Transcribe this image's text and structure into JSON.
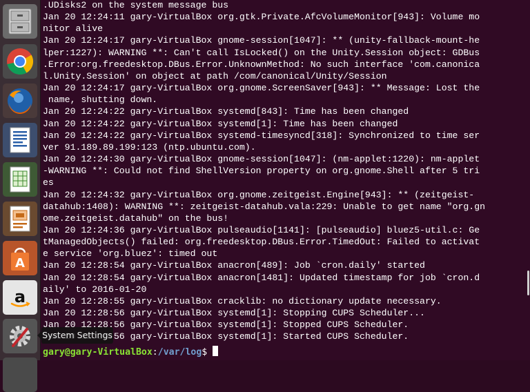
{
  "launcher": {
    "items": [
      {
        "name": "Files",
        "icon": "file-cabinet-icon"
      },
      {
        "name": "Chromium Web Browser",
        "icon": "chrome-icon"
      },
      {
        "name": "Firefox Web Browser",
        "icon": "firefox-icon"
      },
      {
        "name": "LibreOffice Writer",
        "icon": "writer-document-icon"
      },
      {
        "name": "LibreOffice Calc",
        "icon": "calc-spreadsheet-icon"
      },
      {
        "name": "LibreOffice Impress",
        "icon": "impress-presentation-icon"
      },
      {
        "name": "Ubuntu Software Center",
        "icon": "software-center-bag-icon"
      },
      {
        "name": "Amazon",
        "icon": "amazon-icon"
      },
      {
        "name": "System Settings",
        "icon": "settings-gear-wrench-icon"
      }
    ],
    "tooltip": "System Settings"
  },
  "terminal": {
    "lines": [
      ".UDisks2 on the system message bus",
      "Jan 20 12:24:11 gary-VirtualBox org.gtk.Private.AfcVolumeMonitor[943]: Volume mo",
      "nitor alive",
      "Jan 20 12:24:17 gary-VirtualBox gnome-session[1047]: ** (unity-fallback-mount-he",
      "lper:1227): WARNING **: Can't call IsLocked() on the Unity.Session object: GDBus",
      ".Error:org.freedesktop.DBus.Error.UnknownMethod: No such interface 'com.canonica",
      "l.Unity.Session' on object at path /com/canonical/Unity/Session",
      "Jan 20 12:24:17 gary-VirtualBox org.gnome.ScreenSaver[943]: ** Message: Lost the",
      " name, shutting down.",
      "Jan 20 12:24:22 gary-VirtualBox systemd[843]: Time has been changed",
      "Jan 20 12:24:22 gary-VirtualBox systemd[1]: Time has been changed",
      "Jan 20 12:24:22 gary-VirtualBox systemd-timesyncd[318]: Synchronized to time ser",
      "ver 91.189.89.199:123 (ntp.ubuntu.com).",
      "Jan 20 12:24:30 gary-VirtualBox gnome-session[1047]: (nm-applet:1220): nm-applet",
      "-WARNING **: Could not find ShellVersion property on org.gnome.Shell after 5 tri",
      "es",
      "Jan 20 12:24:32 gary-VirtualBox org.gnome.zeitgeist.Engine[943]: ** (zeitgeist-",
      "datahub:1408): WARNING **: zeitgeist-datahub.vala:229: Unable to get name \"org.gn",
      "ome.zeitgeist.datahub\" on the bus!",
      "Jan 20 12:24:36 gary-VirtualBox pulseaudio[1141]: [pulseaudio] bluez5-util.c: Ge",
      "tManagedObjects() failed: org.freedesktop.DBus.Error.TimedOut: Failed to activat",
      "e service 'org.bluez': timed out",
      "Jan 20 12:28:54 gary-VirtualBox anacron[489]: Job `cron.daily' started",
      "Jan 20 12:28:54 gary-VirtualBox anacron[1481]: Updated timestamp for job `cron.d",
      "aily' to 2016-01-20",
      "Jan 20 12:28:55 gary-VirtualBox cracklib: no dictionary update necessary.",
      "Jan 20 12:28:56 gary-VirtualBox systemd[1]: Stopping CUPS Scheduler...",
      "Jan 20 12:28:56 gary-VirtualBox systemd[1]: Stopped CUPS Scheduler.",
      "Jan 20 12:28:56 gary-VirtualBox systemd[1]: Started CUPS Scheduler."
    ],
    "prompt": {
      "user_host": "gary@gary-VirtualBox",
      "separator": ":",
      "path": "/var/log",
      "symbol": "$ "
    }
  }
}
